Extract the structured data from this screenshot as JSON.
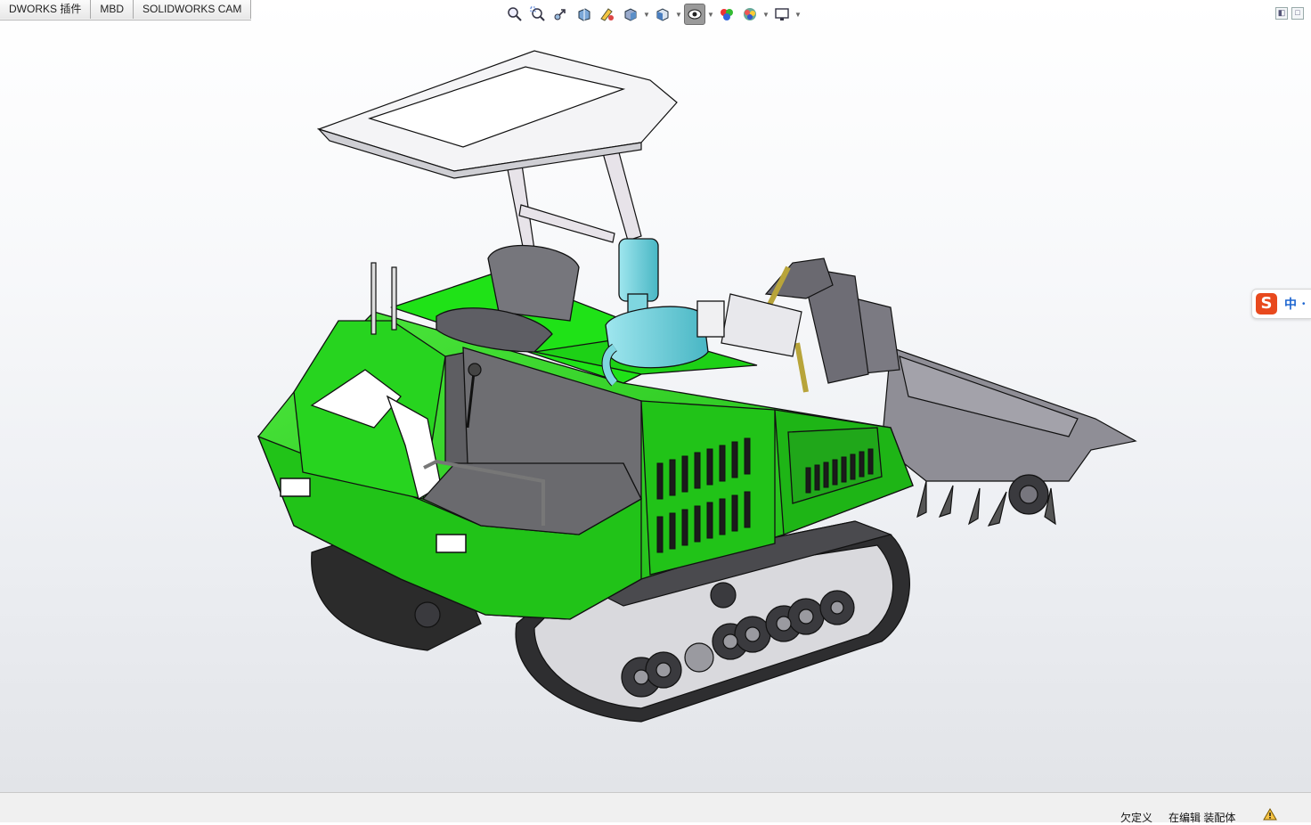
{
  "command_tabs": [
    {
      "label": "DWORKS 插件"
    },
    {
      "label": "MBD"
    },
    {
      "label": "SOLIDWORKS CAM"
    }
  ],
  "heads_up_toolbar": [
    {
      "icon": "zoom-to-fit-icon"
    },
    {
      "icon": "zoom-to-area-icon"
    },
    {
      "icon": "previous-view-icon"
    },
    {
      "icon": "section-view-icon"
    },
    {
      "icon": "dynamic-annotation-view-icon"
    },
    {
      "icon": "view-orientation-icon",
      "dropdown": true
    },
    {
      "icon": "display-style-icon",
      "dropdown": true
    },
    {
      "icon": "hide-show-items-icon",
      "dropdown": true,
      "active": true
    },
    {
      "icon": "edit-appearance-icon"
    },
    {
      "icon": "apply-scene-icon",
      "dropdown": true
    },
    {
      "icon": "view-settings-icon",
      "dropdown": true
    }
  ],
  "ime_bar": {
    "logo": "S",
    "mode": "中",
    "extra": "•"
  },
  "statusbar": {
    "underdefined": "欠定义",
    "editing": "在编辑 装配体"
  },
  "colors": {
    "body_green": "#25d21d",
    "dark_green": "#1aa514",
    "airbox_cyan": "#7fd6e0",
    "metal_gray": "#8e8e94",
    "track_black": "#2b2b2b"
  }
}
